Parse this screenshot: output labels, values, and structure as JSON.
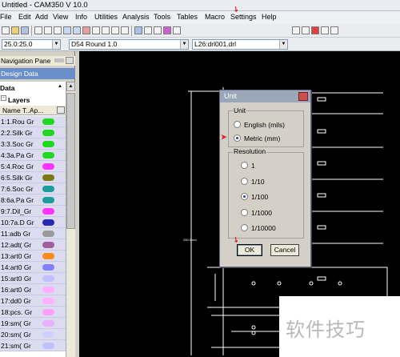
{
  "window": {
    "title": "Untitled - CAM350 V 10.0"
  },
  "menu": [
    "File",
    "Edit",
    "Add",
    "View",
    "Info",
    "Utilities",
    "Analysis",
    "Tools",
    "Tables",
    "Macro",
    "Settings",
    "Help"
  ],
  "toolbar2": {
    "coords": "25.0:25.0",
    "dcode": "D54  Round 1.0",
    "layer": "L26:drl001.drl"
  },
  "nav_pane": {
    "title": "Navigation Pane",
    "tab": "Design Data",
    "tree_root": "Data",
    "layers_label": "Layers",
    "columns": "Name  T..Ap...",
    "layers": [
      {
        "name": "1:1.Rou Gr",
        "color": "#1fd81f"
      },
      {
        "name": "2:2.Silk Gr",
        "color": "#1fd81f"
      },
      {
        "name": "3:3.Soc Gr",
        "color": "#1fd81f"
      },
      {
        "name": "4:3a.Pa Gr",
        "color": "#1fd81f"
      },
      {
        "name": "5:4.Roc Gr",
        "color": "#ff35ff"
      },
      {
        "name": "6:5.Silk Gr",
        "color": "#7a7a10"
      },
      {
        "name": "7:6.Soc Gr",
        "color": "#1e9c9c"
      },
      {
        "name": "8:6a.Pa Gr",
        "color": "#1e9c9c"
      },
      {
        "name": "9:7.Dil_Gr",
        "color": "#ff35ff"
      },
      {
        "name": "10:7a.D Gr",
        "color": "#2a2ab0"
      },
      {
        "name": "11:adb Gr",
        "color": "#9a9a9a"
      },
      {
        "name": "12:adt( Gr",
        "color": "#a060a0"
      },
      {
        "name": "13:art0 Gr",
        "color": "#ff8c1a"
      },
      {
        "name": "14:art0 Gr",
        "color": "#8080ff"
      },
      {
        "name": "15:art0 Gr",
        "color": "#c0c0ff"
      },
      {
        "name": "16:art0 Gr",
        "color": "#ffb0ff"
      },
      {
        "name": "17:dd0 Gr",
        "color": "#ffb0ff"
      },
      {
        "name": "18:pcs. Gr",
        "color": "#ffa0ff"
      },
      {
        "name": "19:sm( Gr",
        "color": "#e8b0ff"
      },
      {
        "name": "20:sm( Gr",
        "color": "#d0d0ff"
      },
      {
        "name": "21:sm( Gr",
        "color": "#c0c0ff"
      }
    ]
  },
  "canvas": {
    "dim_label": "250.0mm"
  },
  "dialog": {
    "title": "Unit",
    "unit_group": "Unit",
    "unit_options": [
      {
        "label": "English (mils)",
        "selected": false
      },
      {
        "label": "Metric (mm)",
        "selected": true
      }
    ],
    "resolution_group": "Resolution",
    "resolution_options": [
      {
        "label": "1",
        "selected": false
      },
      {
        "label": "1/10",
        "selected": false
      },
      {
        "label": "1/100",
        "selected": true
      },
      {
        "label": "1/1000",
        "selected": false
      },
      {
        "label": "1/10000",
        "selected": false
      }
    ],
    "ok_label": "OK",
    "cancel_label": "Cancel"
  },
  "watermark": {
    "text": "软件技巧"
  },
  "colors": {
    "canvas_bg": "#000000",
    "outline": "#ffffff",
    "accent_arrow": "#e02020",
    "nav_tab": "#6a8ec8"
  }
}
